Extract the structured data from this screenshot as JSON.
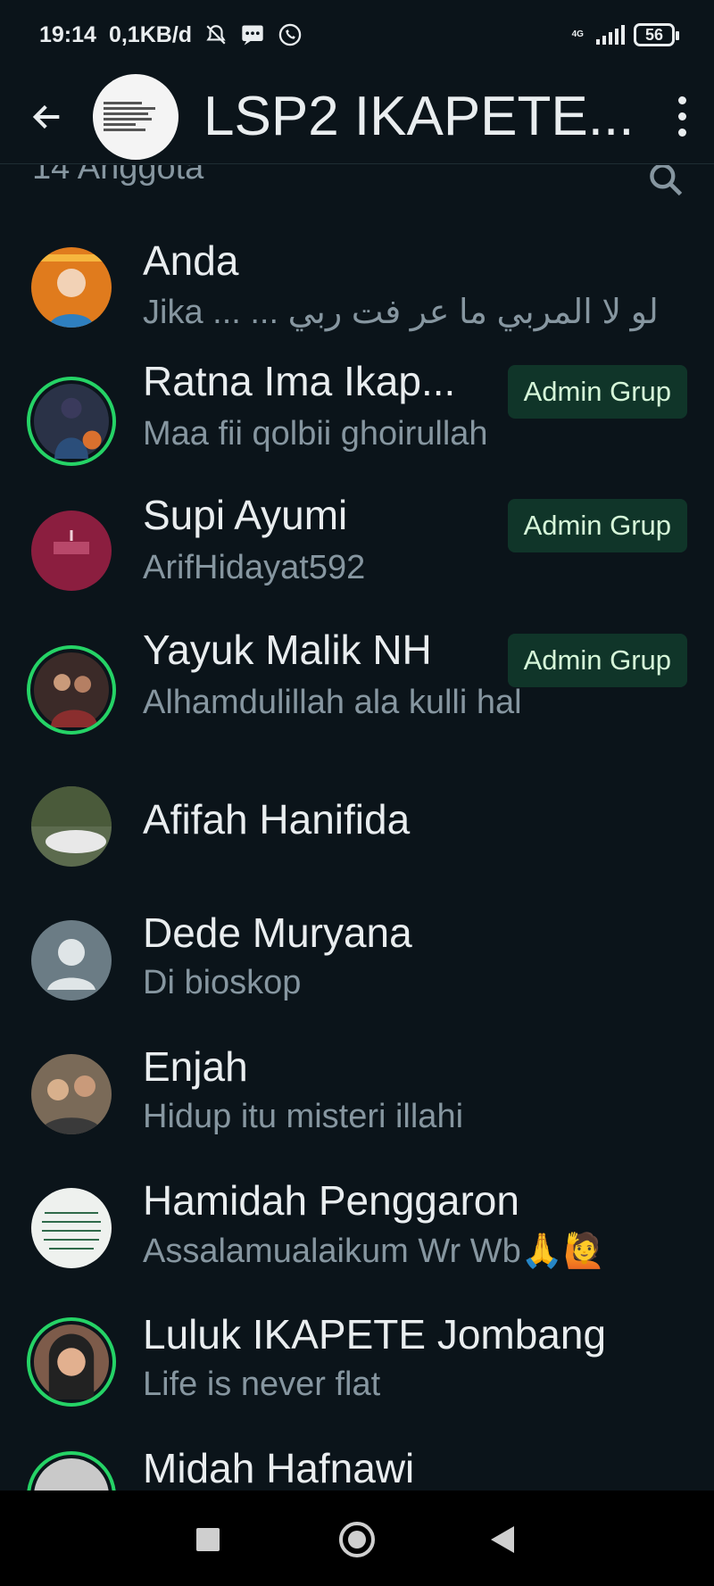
{
  "status_bar": {
    "time": "19:14",
    "data_rate": "0,1KB/d",
    "network": "4G",
    "battery": "56"
  },
  "app_bar": {
    "title": "LSP2 IKAPETE...",
    "icons": [
      "back-arrow-icon",
      "more-vert-icon"
    ]
  },
  "subheader": {
    "member_count": "14 Anggota",
    "icon": "search-icon"
  },
  "colors": {
    "background": "#0b141a",
    "status_ring": "#25d366",
    "badge_bg": "#103529",
    "badge_text": "#d6f7d9",
    "secondary_text": "#8696a0"
  },
  "members": [
    {
      "name": "Anda",
      "about": "Jika ... ... لو لا المربي ما عر فت ربي",
      "admin": "",
      "avatar_color": "#e07b1d",
      "status_ring": false
    },
    {
      "name": "Ratna Ima Ikap...",
      "about": "Maa fii qolbii ghoirullah",
      "admin": "Admin Grup",
      "avatar_color": "#2a3247",
      "status_ring": true
    },
    {
      "name": "Supi Ayumi",
      "about": "ArifHidayat592",
      "admin": "Admin Grup",
      "avatar_color": "#8b1e3f",
      "status_ring": false
    },
    {
      "name": "Yayuk Malik NH",
      "about": "Alhamdulillah ala kulli hal",
      "admin": "Admin Grup",
      "avatar_color": "#3b2a28",
      "status_ring": true
    },
    {
      "name": "Afifah Hanifida",
      "about": "",
      "admin": "",
      "avatar_color": "#5c6b4e",
      "status_ring": false
    },
    {
      "name": "Dede Muryana",
      "about": "Di bioskop",
      "admin": "",
      "avatar_color": "#6b7c85",
      "status_ring": false
    },
    {
      "name": "Enjah",
      "about": "Hidup itu misteri illahi",
      "admin": "",
      "avatar_color": "#7a6a58",
      "status_ring": false
    },
    {
      "name": "Hamidah Penggaron",
      "about": "Assalamualaikum Wr Wb🙏🙋",
      "admin": "",
      "avatar_color": "#eef1ee",
      "status_ring": false
    },
    {
      "name": "Luluk IKAPETE Jombang",
      "about": "Life is never flat",
      "admin": "",
      "avatar_color": "#7d5b4a",
      "status_ring": true
    },
    {
      "name": "Midah Hafnawi",
      "about": "",
      "admin": "",
      "avatar_color": "#c9c9c9",
      "status_ring": true
    }
  ]
}
